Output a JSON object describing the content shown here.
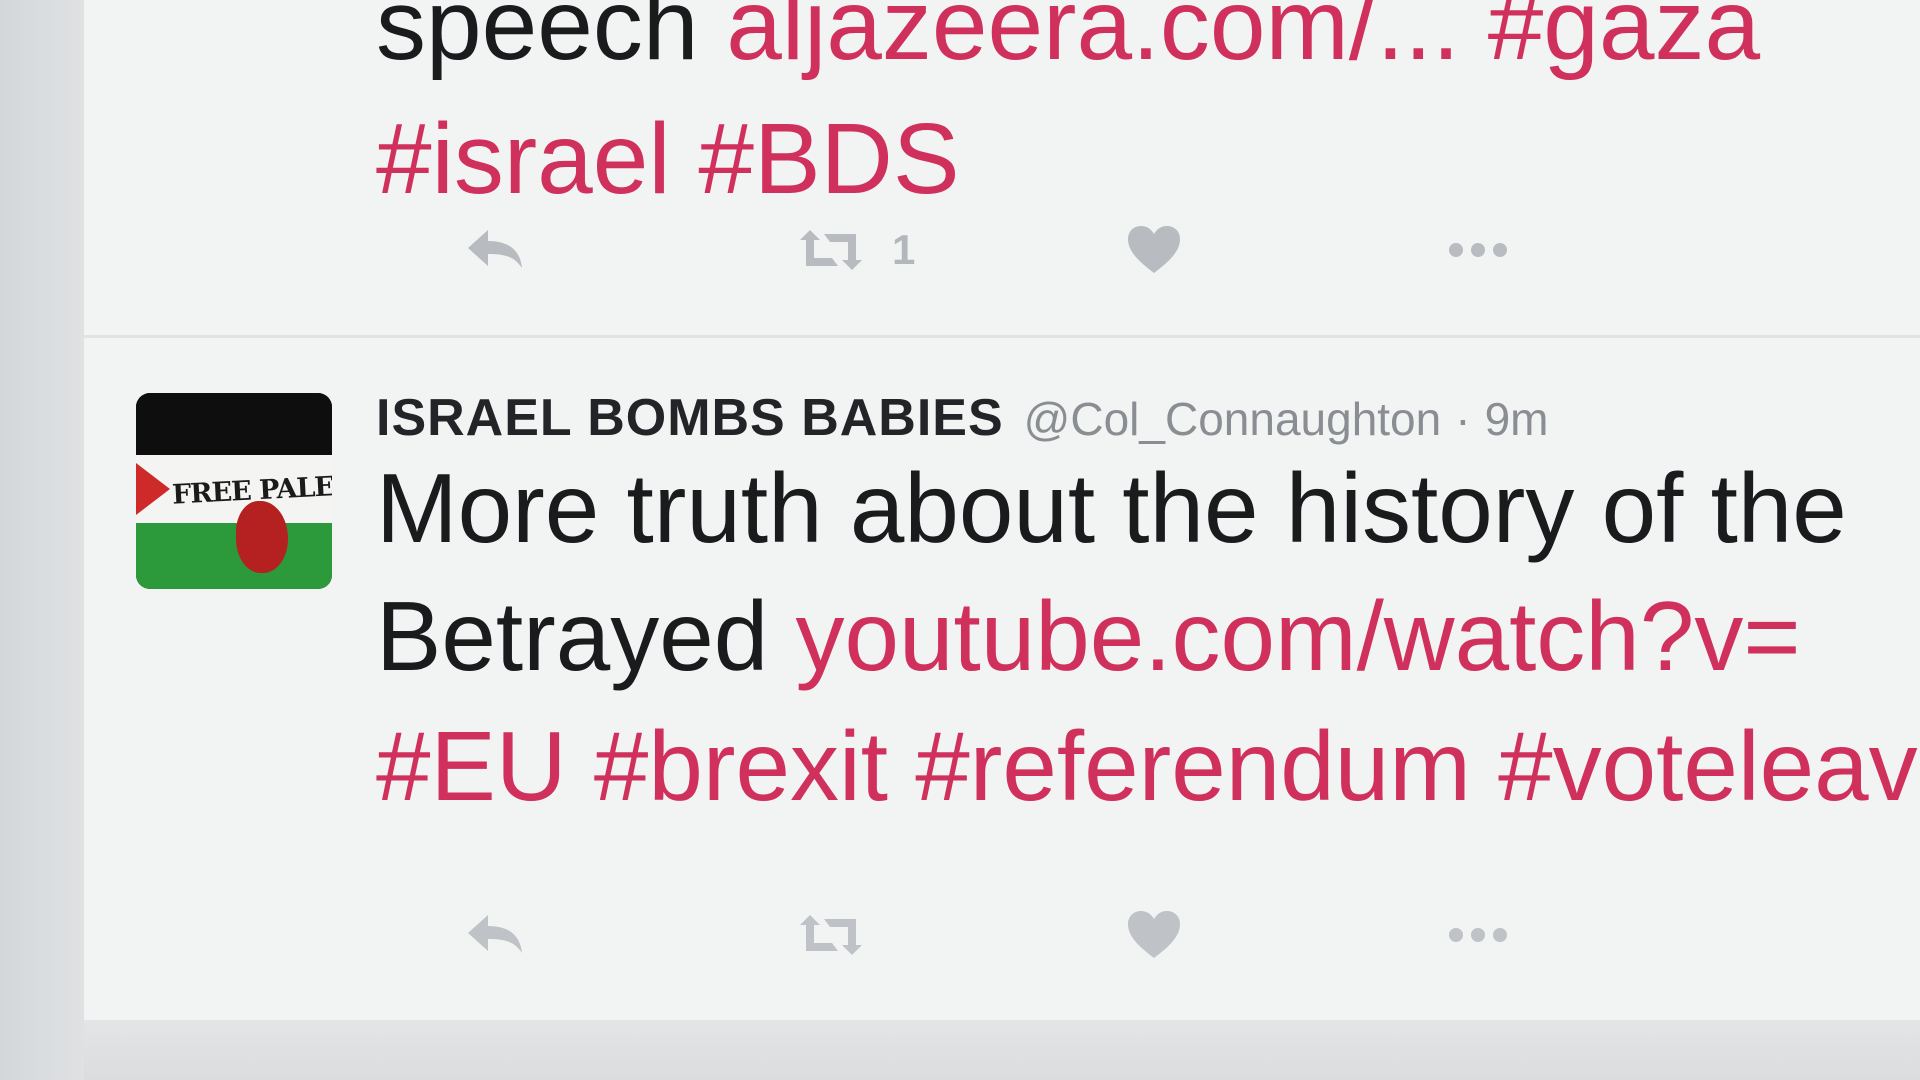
{
  "tweets": [
    {
      "text_line_a_plain": "speech ",
      "text_line_a_link": "aljazeera.com/...",
      "text_line_a_hashtag": " #gaza",
      "text_line_b_hashtags": "#israel #BDS",
      "actions": {
        "reply_icon": "reply-icon",
        "retweet_icon": "retweet-icon",
        "retweet_count": "1",
        "like_icon": "heart-icon",
        "more_icon": "more-dots-icon"
      }
    },
    {
      "display_name": "ISRAEL BOMBS BABIES",
      "handle": "@Col_Connaughton",
      "separator": "·",
      "time": "9m",
      "avatar_text": "FREE PALES",
      "line_1": "More truth about the history of the",
      "line_2_plain": "Betrayed ",
      "line_2_link": "youtube.com/watch?v=",
      "line_3_hashtags": "#EU #brexit #referendum #voteleave",
      "actions": {
        "reply_icon": "reply-icon",
        "retweet_icon": "retweet-icon",
        "like_icon": "heart-icon",
        "more_icon": "more-dots-icon"
      }
    }
  ],
  "colors": {
    "link": "#d0305c",
    "text": "#1a1b1d",
    "muted": "#8a8e93",
    "icon": "#b8bcc0"
  }
}
